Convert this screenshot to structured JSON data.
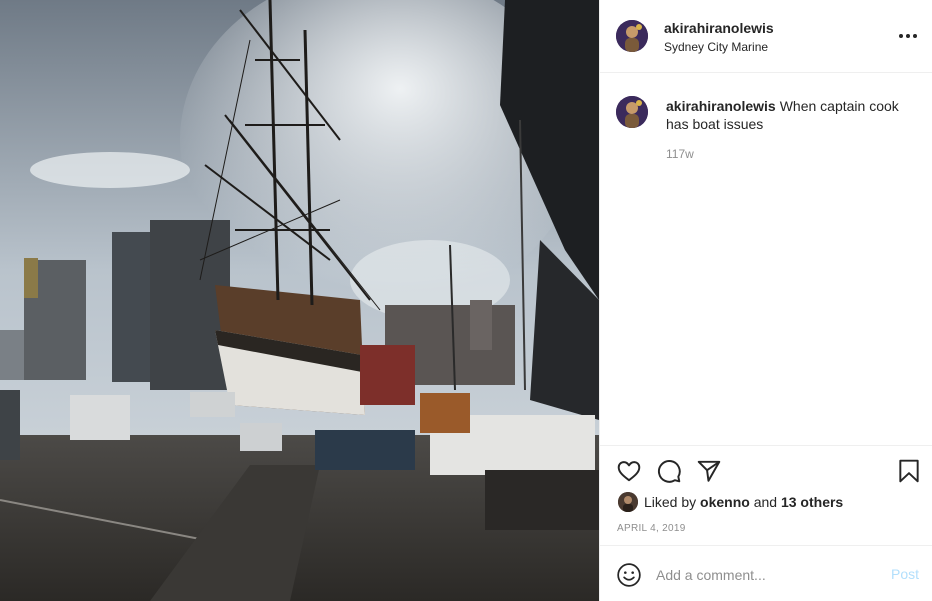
{
  "post": {
    "username": "akirahiranolewis",
    "location": "Sydney City Marine",
    "image_description_icon": "photo"
  },
  "header": {
    "more_icon": "more-horizontal-icon"
  },
  "caption": {
    "username": "akirahiranolewis",
    "text": "When captain cook has boat issues",
    "time": "117w"
  },
  "actions": {
    "like_icon": "heart-icon",
    "comment_icon": "comment-icon",
    "share_icon": "paper-plane-icon",
    "save_icon": "bookmark-icon"
  },
  "likes": {
    "prefix": "Liked by",
    "user": "okenno",
    "joiner": "and",
    "others": "13 others"
  },
  "date": "APRIL 4, 2019",
  "add_comment": {
    "placeholder": "Add a comment...",
    "post_label": "Post",
    "emoji_icon": "smiley-icon"
  },
  "colors": {
    "text": "#262626",
    "secondary": "#8e8e8e",
    "post_disabled": "#b2dffc",
    "divider": "#efefef"
  }
}
